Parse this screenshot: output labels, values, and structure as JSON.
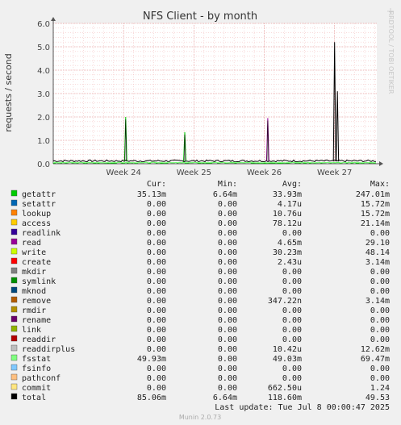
{
  "chart_data": {
    "type": "line",
    "title": "NFS Client - by month",
    "ylabel": "requests / second",
    "side_label": "RRDTOOL / TOBI OETIKER",
    "ylim": [
      0,
      6
    ],
    "y_ticks": [
      "0.0",
      "1.0",
      "2.0",
      "3.0",
      "4.0",
      "5.0",
      "6.0"
    ],
    "x_ticks": [
      "Week 24",
      "Week 25",
      "Week 26",
      "Week 27"
    ],
    "columns": {
      "cur": "Cur:",
      "min": "Min:",
      "avg": "Avg:",
      "max": "Max:"
    },
    "series": [
      {
        "name": "getattr",
        "color": "#00cc00",
        "cur": "35.13m",
        "min": "6.64m",
        "avg": "33.93m",
        "max": "247.01m"
      },
      {
        "name": "setattr",
        "color": "#0066b3",
        "cur": "0.00",
        "min": "0.00",
        "avg": "4.17u",
        "max": "15.72m"
      },
      {
        "name": "lookup",
        "color": "#ff8000",
        "cur": "0.00",
        "min": "0.00",
        "avg": "10.76u",
        "max": "15.72m"
      },
      {
        "name": "access",
        "color": "#ffcc00",
        "cur": "0.00",
        "min": "0.00",
        "avg": "78.12u",
        "max": "21.14m"
      },
      {
        "name": "readlink",
        "color": "#330099",
        "cur": "0.00",
        "min": "0.00",
        "avg": "0.00",
        "max": "0.00"
      },
      {
        "name": "read",
        "color": "#990099",
        "cur": "0.00",
        "min": "0.00",
        "avg": "4.65m",
        "max": "29.10"
      },
      {
        "name": "write",
        "color": "#ccff00",
        "cur": "0.00",
        "min": "0.00",
        "avg": "30.23m",
        "max": "48.14"
      },
      {
        "name": "create",
        "color": "#ff0000",
        "cur": "0.00",
        "min": "0.00",
        "avg": "2.43u",
        "max": "3.14m"
      },
      {
        "name": "mkdir",
        "color": "#808080",
        "cur": "0.00",
        "min": "0.00",
        "avg": "0.00",
        "max": "0.00"
      },
      {
        "name": "symlink",
        "color": "#008f00",
        "cur": "0.00",
        "min": "0.00",
        "avg": "0.00",
        "max": "0.00"
      },
      {
        "name": "mknod",
        "color": "#00487d",
        "cur": "0.00",
        "min": "0.00",
        "avg": "0.00",
        "max": "0.00"
      },
      {
        "name": "remove",
        "color": "#b35a00",
        "cur": "0.00",
        "min": "0.00",
        "avg": "347.22n",
        "max": "3.14m"
      },
      {
        "name": "rmdir",
        "color": "#b38f00",
        "cur": "0.00",
        "min": "0.00",
        "avg": "0.00",
        "max": "0.00"
      },
      {
        "name": "rename",
        "color": "#6b006b",
        "cur": "0.00",
        "min": "0.00",
        "avg": "0.00",
        "max": "0.00"
      },
      {
        "name": "link",
        "color": "#8fb300",
        "cur": "0.00",
        "min": "0.00",
        "avg": "0.00",
        "max": "0.00"
      },
      {
        "name": "readdir",
        "color": "#b30000",
        "cur": "0.00",
        "min": "0.00",
        "avg": "0.00",
        "max": "0.00"
      },
      {
        "name": "readdirplus",
        "color": "#bebebe",
        "cur": "0.00",
        "min": "0.00",
        "avg": "10.42u",
        "max": "12.62m"
      },
      {
        "name": "fsstat",
        "color": "#80ff80",
        "cur": "49.93m",
        "min": "0.00",
        "avg": "49.03m",
        "max": "69.47m"
      },
      {
        "name": "fsinfo",
        "color": "#80c9ff",
        "cur": "0.00",
        "min": "0.00",
        "avg": "0.00",
        "max": "0.00"
      },
      {
        "name": "pathconf",
        "color": "#ffc080",
        "cur": "0.00",
        "min": "0.00",
        "avg": "0.00",
        "max": "0.00"
      },
      {
        "name": "commit",
        "color": "#ffe680",
        "cur": "0.00",
        "min": "0.00",
        "avg": "662.50u",
        "max": "1.24"
      },
      {
        "name": "total",
        "color": "#000000",
        "cur": "85.06m",
        "min": "6.64m",
        "avg": "118.60m",
        "max": "49.53"
      }
    ],
    "spikes": [
      {
        "x": 1.03,
        "y": 2.0,
        "color": "#00cc00"
      },
      {
        "x": 1.87,
        "y": 1.35,
        "color": "#00cc00"
      },
      {
        "x": 3.05,
        "y": 1.95,
        "color": "#990099"
      },
      {
        "x": 4.0,
        "y": 5.2,
        "color": "#000000"
      },
      {
        "x": 4.04,
        "y": 3.1,
        "color": "#000000"
      }
    ],
    "last_update": "Last update:  Tue Jul  8 00:00:47 2025",
    "footer": "Munin 2.0.73",
    "grid": true
  }
}
